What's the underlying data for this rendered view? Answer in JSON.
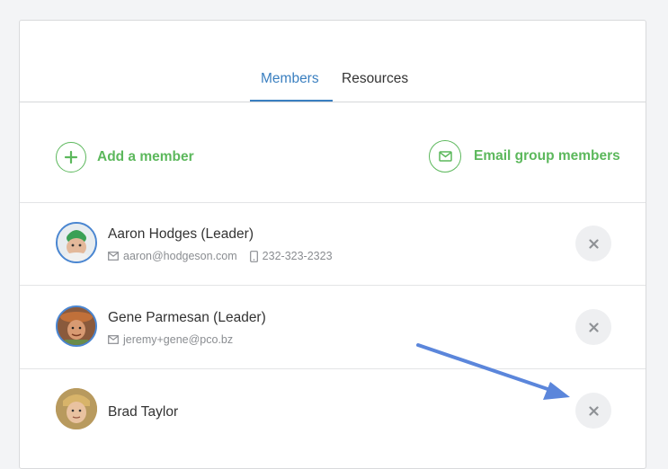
{
  "tabs": [
    {
      "label": "Members",
      "active": true
    },
    {
      "label": "Resources",
      "active": false
    }
  ],
  "actions": {
    "add_member": "Add a member",
    "email_group": "Email group members"
  },
  "members": [
    {
      "name": "Aaron Hodges (Leader)",
      "email": "aaron@hodgeson.com",
      "phone": "232-323-2323"
    },
    {
      "name": "Gene Parmesan (Leader)",
      "email": "jeremy+gene@pco.bz"
    },
    {
      "name": "Brad Taylor"
    }
  ],
  "colors": {
    "accent": "#3a7fc0",
    "green": "#5cb85c",
    "annotation_arrow": "#5b86db"
  },
  "icons": {
    "add": "plus-icon",
    "email": "envelope-icon",
    "phone": "mobile-phone-icon",
    "remove": "close-icon"
  }
}
